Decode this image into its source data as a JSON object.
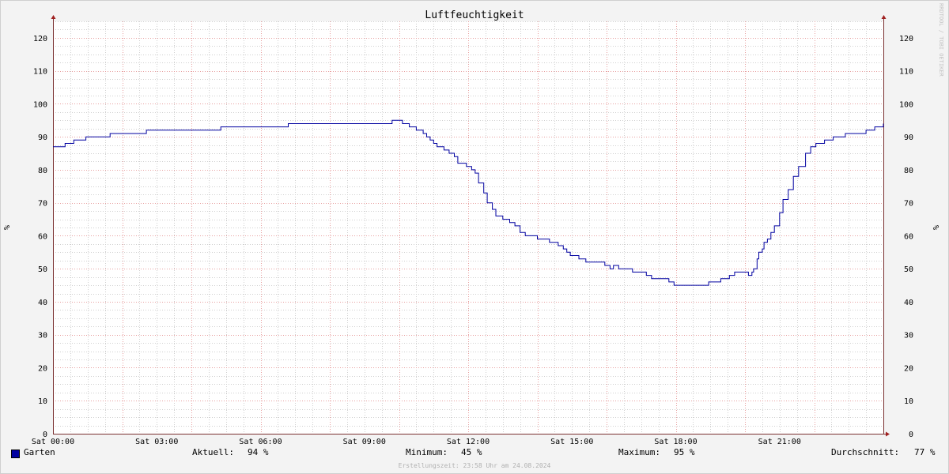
{
  "chart_data": {
    "type": "line",
    "title": "Luftfeuchtigkeit",
    "ylabel": "%",
    "xlabel": "",
    "ylim": [
      0,
      125
    ],
    "xlim": [
      0,
      24
    ],
    "grid": true,
    "yticks": [
      0,
      10,
      20,
      30,
      40,
      50,
      60,
      70,
      80,
      90,
      100,
      110,
      120
    ],
    "xticks": [
      {
        "hour": 0,
        "label": "Sat 00:00"
      },
      {
        "hour": 3,
        "label": "Sat 03:00"
      },
      {
        "hour": 6,
        "label": "Sat 06:00"
      },
      {
        "hour": 9,
        "label": "Sat 09:00"
      },
      {
        "hour": 12,
        "label": "Sat 12:00"
      },
      {
        "hour": 15,
        "label": "Sat 15:00"
      },
      {
        "hour": 18,
        "label": "Sat 18:00"
      },
      {
        "hour": 21,
        "label": "Sat 21:00"
      }
    ],
    "series": [
      {
        "name": "Garten",
        "color": "#0000a0",
        "x": [
          0.0,
          0.1,
          0.35,
          0.6,
          0.95,
          1.65,
          2.7,
          4.85,
          6.8,
          9.8,
          10.1,
          10.3,
          10.5,
          10.7,
          10.8,
          10.9,
          11.0,
          11.1,
          11.3,
          11.45,
          11.55,
          11.6,
          11.7,
          11.8,
          11.95,
          12.1,
          12.2,
          12.3,
          12.45,
          12.55,
          12.7,
          12.8,
          13.0,
          13.2,
          13.35,
          13.5,
          13.65,
          13.85,
          14.0,
          14.35,
          14.6,
          14.75,
          14.85,
          14.95,
          15.05,
          15.2,
          15.4,
          15.5,
          15.55,
          15.95,
          16.1,
          16.2,
          16.35,
          16.5,
          16.75,
          16.95,
          17.15,
          17.3,
          17.6,
          17.8,
          17.95,
          18.05,
          18.6,
          18.95,
          19.3,
          19.55,
          19.7,
          20.0,
          20.1,
          20.15,
          20.2,
          20.25,
          20.35,
          20.4,
          20.5,
          20.55,
          20.65,
          20.75,
          20.85,
          21.0,
          21.1,
          21.25,
          21.4,
          21.55,
          21.75,
          21.9,
          22.05,
          22.3,
          22.55,
          22.9,
          23.5,
          23.75,
          24.0
        ],
        "values": [
          87,
          87,
          88,
          89,
          90,
          91,
          92,
          93,
          94,
          95,
          94,
          93,
          92,
          91,
          90,
          89,
          88,
          87,
          86,
          85,
          85,
          84,
          82,
          82,
          81,
          80,
          79,
          76,
          73,
          70,
          68,
          66,
          65,
          64,
          63,
          61,
          60,
          60,
          59,
          58,
          57,
          56,
          55,
          54,
          54,
          53,
          52,
          52,
          52,
          51,
          50,
          51,
          50,
          50,
          49,
          49,
          48,
          47,
          47,
          46,
          45,
          45,
          45,
          46,
          47,
          48,
          49,
          49,
          48,
          48,
          49,
          50,
          53,
          55,
          56,
          58,
          59,
          61,
          63,
          67,
          71,
          74,
          78,
          81,
          85,
          87,
          88,
          89,
          90,
          91,
          92,
          93,
          94
        ]
      }
    ]
  },
  "legend": {
    "series_name": "Garten",
    "current_label": "Aktuell:",
    "current_value": "94 %",
    "min_label": "Minimum:",
    "min_value": "45 %",
    "max_label": "Maximum:",
    "max_value": "95 %",
    "avg_label": "Durchschnitt:",
    "avg_value": "77 %"
  },
  "footer": "Erstellungszeit: 23:58 Uhr am 24.08.2024",
  "watermark": "RRDTOOL / TOBI OETIKER",
  "colors": {
    "background": "#f3f3f3",
    "plot": "#ffffff",
    "major_grid": "#e8a0a0",
    "minor_grid": "#d0d0d0",
    "axis": "#7a3030",
    "line": "#0000a0"
  }
}
